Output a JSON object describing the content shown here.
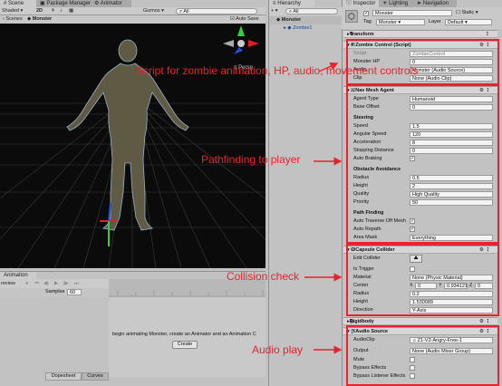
{
  "scene_tabs": [
    "Scene",
    "Package Manager",
    "Animator"
  ],
  "scene_toolbar": {
    "shading": "Shaded",
    "mode_2d": "2D",
    "gizmos": "Gizmos",
    "search_all": "All"
  },
  "breadcrumb": {
    "root": "Scenes",
    "current": "Monster"
  },
  "auto_save": "Auto Save",
  "gizmo_label": "Persp",
  "hierarchy": {
    "tab": "Hierarchy",
    "search_placeholder": "All",
    "root": "Monster",
    "child": "Zombie1"
  },
  "inspector": {
    "tabs": [
      "Inspector",
      "Lighting",
      "Navigation"
    ],
    "object_name": "Monster",
    "static_label": "Static",
    "tag_label": "Tag",
    "tag_value": "Monster",
    "layer_label": "Layer",
    "layer_value": "Default",
    "transform_label": "Transform",
    "zombie_control": {
      "header": "Zombie Control (Script)",
      "rows": [
        {
          "label": "Script",
          "value": "ZombieControl"
        },
        {
          "label": "Monster HP",
          "value": "0"
        },
        {
          "label": "Audio",
          "value": "Monster (Audio Source)"
        },
        {
          "label": "Clip",
          "value": "None (Audio Clip)"
        }
      ]
    },
    "nav_mesh": {
      "header": "Nav Mesh Agent",
      "agent_type_label": "Agent Type",
      "agent_type_value": "Humanoid",
      "base_offset_label": "Base Offset",
      "base_offset_value": "0",
      "steering_title": "Steering",
      "steering_rows": [
        {
          "label": "Speed",
          "value": "1.5"
        },
        {
          "label": "Angular Speed",
          "value": "120"
        },
        {
          "label": "Acceleration",
          "value": "8"
        },
        {
          "label": "Stopping Distance",
          "value": "0"
        }
      ],
      "auto_braking_label": "Auto Braking",
      "obstacle_title": "Obstacle Avoidance",
      "obstacle_rows": [
        {
          "label": "Radius",
          "value": "0.5"
        },
        {
          "label": "Height",
          "value": "2"
        },
        {
          "label": "Quality",
          "value": "High Quality"
        },
        {
          "label": "Priority",
          "value": "50"
        }
      ],
      "pathfinding_title": "Path Finding",
      "auto_traverse_label": "Auto Traverse Off Mesh",
      "auto_repath_label": "Auto Repath",
      "area_mask_label": "Area Mask",
      "area_mask_value": "Everything"
    },
    "capsule": {
      "header": "Capsule Collider",
      "edit_collider_label": "Edit Collider",
      "is_trigger_label": "Is Trigger",
      "material_label": "Material",
      "material_value": "None (Physic Material)",
      "center_label": "Center",
      "center_x_label": "X",
      "center_x": "0",
      "center_y_label": "Y",
      "center_y": "0.934121",
      "center_z_label": "Z",
      "center_z": "0",
      "radius_label": "Radius",
      "radius_value": "0.2",
      "height_label": "Height",
      "height_value": "1.530089",
      "direction_label": "Direction",
      "direction_value": "Y-Axis"
    },
    "rigidbody_label": "Rigidbody",
    "audio_source": {
      "header": "Audio Source",
      "audio_clip_label": "AudioClip",
      "audio_clip_value": "Z1-V2-Angry-Free-1",
      "output_label": "Output",
      "output_value": "None (Audio Mixer Group)",
      "mute_label": "Mute",
      "bypass_effects_label": "Bypass Effects",
      "bypass_listener_label": "Bypass Listener Effects"
    }
  },
  "animation": {
    "tab": "Animation",
    "preview_label": "review",
    "samples_label": "Samples",
    "samples_value": "60",
    "message": "begin animating Monster, create an Animator and an Animation C",
    "create_button": "Create",
    "bottom_tabs": [
      "Dopesheet",
      "Curves"
    ]
  },
  "annotations": {
    "script": "Script for zombie animation, HP, audio, movement controls",
    "pathfinding": "Pathfinding to player",
    "collision": "Collision check",
    "audio": "Audio play"
  },
  "colors": {
    "annotation": "#e8222e",
    "scene_bg": "#0b0b0b",
    "grid": "#3a3a3a",
    "panel": "#c2c2c2"
  }
}
